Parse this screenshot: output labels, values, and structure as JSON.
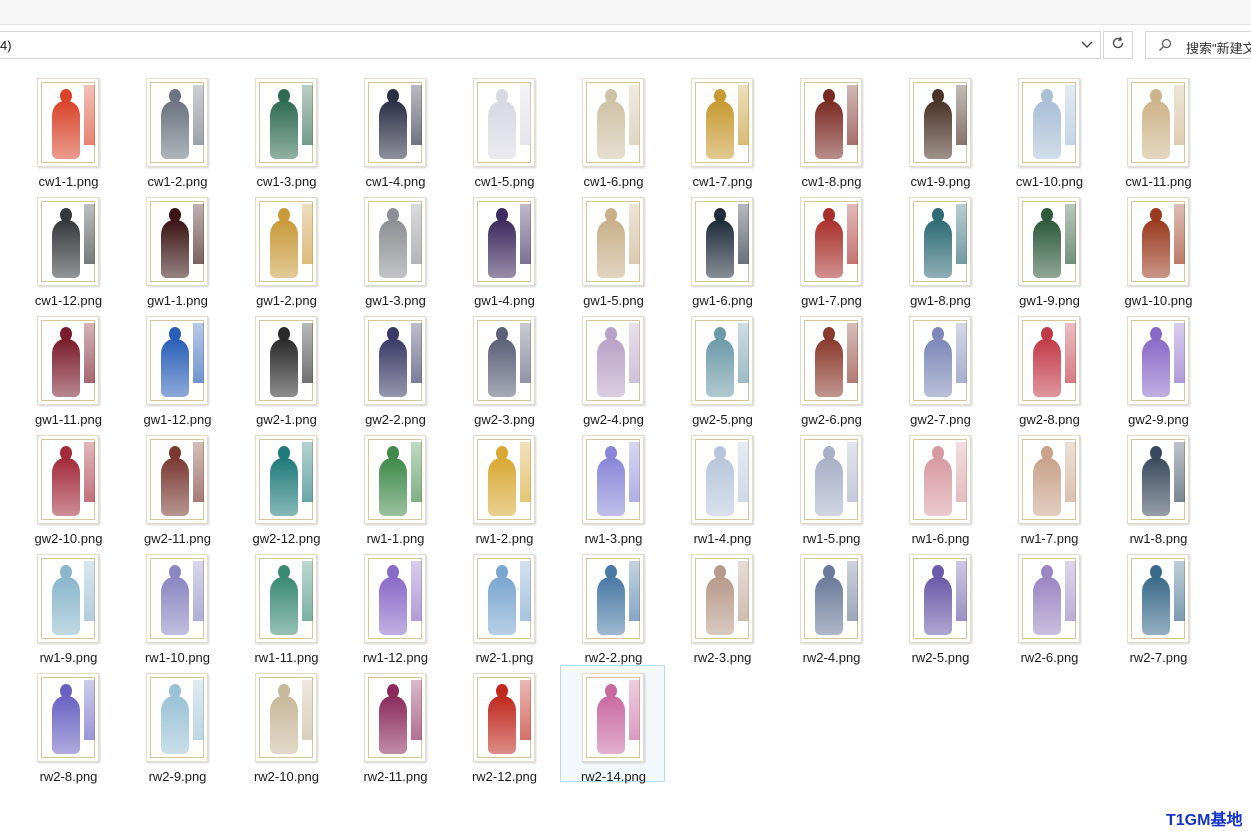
{
  "toolbar": {
    "address_text": "4)",
    "address_dropdown_icon": "chevron-down-icon",
    "refresh_icon": "refresh-icon",
    "search_placeholder": "搜索\"新建文"
  },
  "files": [
    {
      "name": "cw1-1.png",
      "tint": "#d9442a"
    },
    {
      "name": "cw1-2.png",
      "tint": "#6b7480"
    },
    {
      "name": "cw1-3.png",
      "tint": "#2f6b52"
    },
    {
      "name": "cw1-4.png",
      "tint": "#2c2f45"
    },
    {
      "name": "cw1-5.png",
      "tint": "#d8d8e2"
    },
    {
      "name": "cw1-6.png",
      "tint": "#cfc3a6"
    },
    {
      "name": "cw1-7.png",
      "tint": "#c79a32"
    },
    {
      "name": "cw1-8.png",
      "tint": "#7a2a22"
    },
    {
      "name": "cw1-9.png",
      "tint": "#4a3226"
    },
    {
      "name": "cw1-10.png",
      "tint": "#a9bfd6"
    },
    {
      "name": "cw1-11.png",
      "tint": "#cdb48a"
    },
    {
      "name": "cw1-12.png",
      "tint": "#34383c"
    },
    {
      "name": "gw1-1.png",
      "tint": "#3b1414"
    },
    {
      "name": "gw1-2.png",
      "tint": "#c99a3a"
    },
    {
      "name": "gw1-3.png",
      "tint": "#8d8f94"
    },
    {
      "name": "gw1-4.png",
      "tint": "#3d2a5e"
    },
    {
      "name": "gw1-5.png",
      "tint": "#c9b08a"
    },
    {
      "name": "gw1-6.png",
      "tint": "#1f2a3a"
    },
    {
      "name": "gw1-7.png",
      "tint": "#a8302c"
    },
    {
      "name": "gw1-8.png",
      "tint": "#2d6a75"
    },
    {
      "name": "gw1-9.png",
      "tint": "#2d5a3a"
    },
    {
      "name": "gw1-10.png",
      "tint": "#9a3a1e"
    },
    {
      "name": "gw1-11.png",
      "tint": "#7a1c2c"
    },
    {
      "name": "gw1-12.png",
      "tint": "#2a5fb8"
    },
    {
      "name": "gw2-1.png",
      "tint": "#2a2a2a"
    },
    {
      "name": "gw2-2.png",
      "tint": "#3b3a66"
    },
    {
      "name": "gw2-3.png",
      "tint": "#5b5f78"
    },
    {
      "name": "gw2-4.png",
      "tint": "#b9a2c8"
    },
    {
      "name": "gw2-5.png",
      "tint": "#6d9aa8"
    },
    {
      "name": "gw2-6.png",
      "tint": "#8a3a2c"
    },
    {
      "name": "gw2-7.png",
      "tint": "#7d88b8"
    },
    {
      "name": "gw2-8.png",
      "tint": "#c23a48"
    },
    {
      "name": "gw2-9.png",
      "tint": "#8a6ac8"
    },
    {
      "name": "gw2-10.png",
      "tint": "#a32a3a"
    },
    {
      "name": "gw2-11.png",
      "tint": "#7a3a32"
    },
    {
      "name": "gw2-12.png",
      "tint": "#1f7a7a"
    },
    {
      "name": "rw1-1.png",
      "tint": "#3f8a4a"
    },
    {
      "name": "rw1-2.png",
      "tint": "#d8a832"
    },
    {
      "name": "rw1-3.png",
      "tint": "#8a86d8"
    },
    {
      "name": "rw1-4.png",
      "tint": "#b8c6dc"
    },
    {
      "name": "rw1-5.png",
      "tint": "#a8b0c8"
    },
    {
      "name": "rw1-6.png",
      "tint": "#d89aa2"
    },
    {
      "name": "rw1-7.png",
      "tint": "#c9a28a"
    },
    {
      "name": "rw1-8.png",
      "tint": "#3a4a5e"
    },
    {
      "name": "rw1-9.png",
      "tint": "#8ab6cc"
    },
    {
      "name": "rw1-10.png",
      "tint": "#8a86c2"
    },
    {
      "name": "rw1-11.png",
      "tint": "#3a8a72"
    },
    {
      "name": "rw1-12.png",
      "tint": "#8a6ac8"
    },
    {
      "name": "rw2-1.png",
      "tint": "#7aa6d0"
    },
    {
      "name": "rw2-2.png",
      "tint": "#4a7aa6"
    },
    {
      "name": "rw2-3.png",
      "tint": "#b89a8a"
    },
    {
      "name": "rw2-4.png",
      "tint": "#6a7a9a"
    },
    {
      "name": "rw2-5.png",
      "tint": "#6a5aa8"
    },
    {
      "name": "rw2-6.png",
      "tint": "#9a86c2"
    },
    {
      "name": "rw2-7.png",
      "tint": "#3a6a8a"
    },
    {
      "name": "rw2-8.png",
      "tint": "#6a62c2"
    },
    {
      "name": "rw2-9.png",
      "tint": "#9ac2d6"
    },
    {
      "name": "rw2-10.png",
      "tint": "#c8b89a"
    },
    {
      "name": "rw2-11.png",
      "tint": "#8a2a5a"
    },
    {
      "name": "rw2-12.png",
      "tint": "#c0281e"
    },
    {
      "name": "rw2-14.png",
      "tint": "#c86aa2",
      "selected": true
    }
  ],
  "watermark": "T1GM基地",
  "colors": {
    "selection_bg": "#f3f8fc",
    "selection_border": "#b9d9ef",
    "watermark": "#1433c8"
  }
}
